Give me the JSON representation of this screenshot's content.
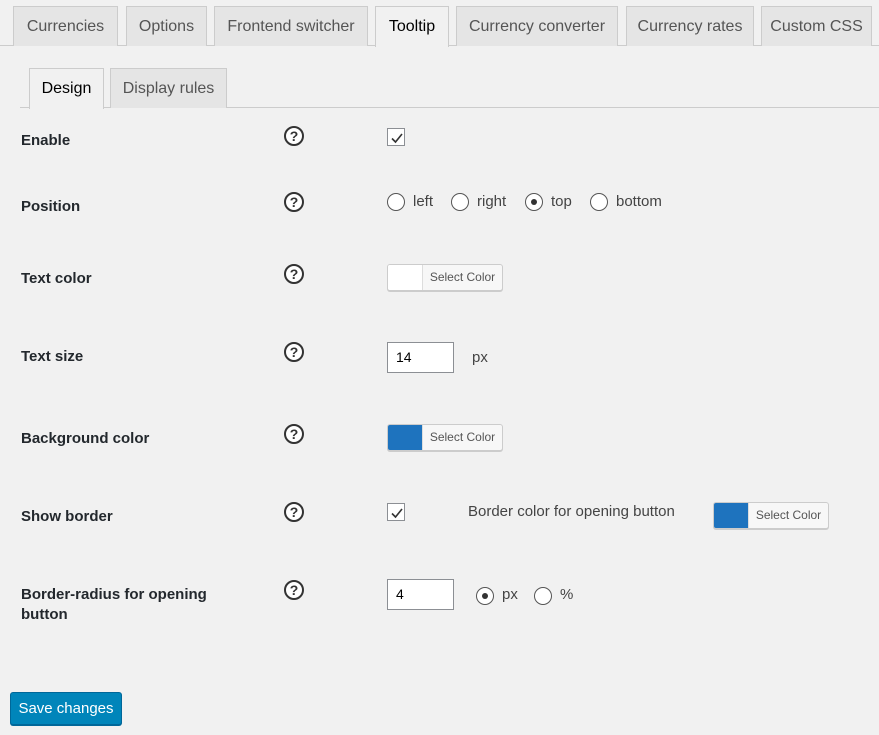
{
  "tabs": [
    {
      "label": "Currencies"
    },
    {
      "label": "Options"
    },
    {
      "label": "Frontend switcher"
    },
    {
      "label": "Tooltip"
    },
    {
      "label": "Currency converter"
    },
    {
      "label": "Currency rates"
    },
    {
      "label": "Custom CSS"
    }
  ],
  "active_tab": "Tooltip",
  "subtabs": [
    {
      "label": "Design"
    },
    {
      "label": "Display rules"
    }
  ],
  "active_subtab": "Design",
  "help_glyph": "?",
  "settings": {
    "enable": {
      "label": "Enable",
      "checked": true
    },
    "position": {
      "label": "Position",
      "options": [
        "left",
        "right",
        "top",
        "bottom"
      ],
      "selected": "top"
    },
    "text_color": {
      "label": "Text color",
      "button": "Select Color",
      "color": "#ffffff"
    },
    "text_size": {
      "label": "Text size",
      "value": "14",
      "unit": "px"
    },
    "background_color": {
      "label": "Background color",
      "button": "Select Color",
      "color": "#1e73be"
    },
    "show_border": {
      "label": "Show border",
      "checked": true,
      "border_color_label": "Border color for opening button",
      "button": "Select Color",
      "color": "#1e73be"
    },
    "border_radius": {
      "label": "Border-radius for opening button",
      "value": "4",
      "units": [
        "px",
        "%"
      ],
      "selected_unit": "px"
    }
  },
  "save_button": "Save changes",
  "colors": {
    "primary": "#0085ba",
    "swatch_blue": "#1e73be"
  }
}
